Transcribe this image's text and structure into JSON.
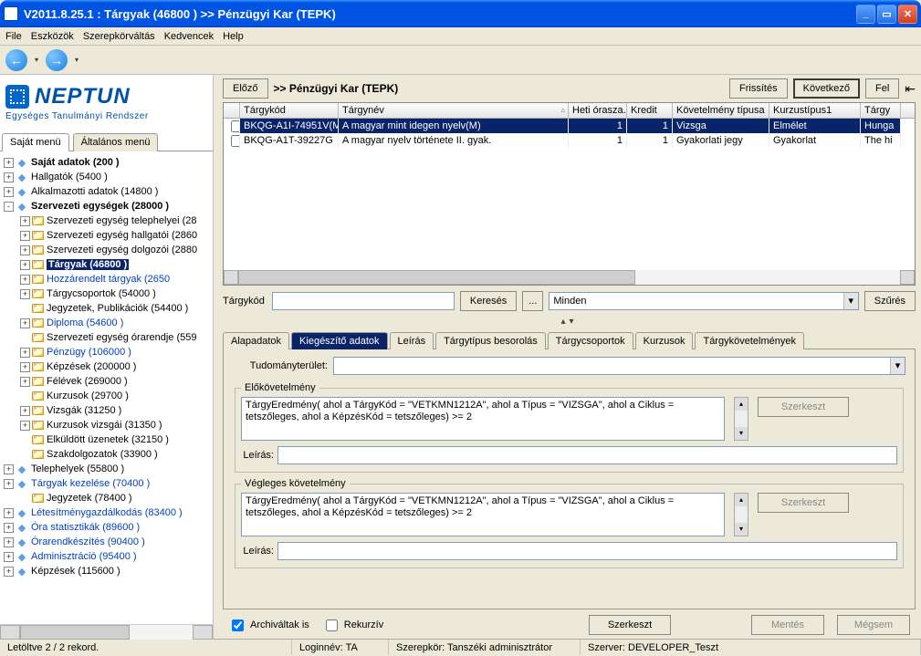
{
  "window": {
    "title": "V2011.8.25.1 : Tárgyak (46800 ) >> Pénzügyi Kar (TEPK)"
  },
  "menu": {
    "file": "File",
    "tools": "Eszközök",
    "role": "Szerepkörváltás",
    "fav": "Kedvencek",
    "help": "Help"
  },
  "logo": {
    "brand": "NEPTUN",
    "sub": "Egységes Tanulmányi Rendszer"
  },
  "left_tabs": {
    "own": "Saját menü",
    "general": "Általános menü"
  },
  "tree": [
    {
      "d": 0,
      "exp": "+",
      "icon": "diamond",
      "bold": true,
      "label": "Saját adatok (200 )"
    },
    {
      "d": 0,
      "exp": "+",
      "icon": "diamond",
      "label": "Hallgatók (5400 )"
    },
    {
      "d": 0,
      "exp": "+",
      "icon": "diamond",
      "label": "Alkalmazotti adatok (14800 )"
    },
    {
      "d": 0,
      "exp": "-",
      "icon": "diamond",
      "bold": true,
      "label": "Szervezeti egységek (28000 )"
    },
    {
      "d": 1,
      "exp": "+",
      "icon": "folder",
      "label": "Szervezeti egység telephelyei (28"
    },
    {
      "d": 1,
      "exp": "+",
      "icon": "folder",
      "label": "Szervezeti egység hallgatói (2860"
    },
    {
      "d": 1,
      "exp": "+",
      "icon": "folder",
      "label": "Szervezeti egység dolgozói (2880"
    },
    {
      "d": 1,
      "exp": "+",
      "icon": "folder",
      "bold": true,
      "sel": true,
      "label": "Tárgyak (46800 )"
    },
    {
      "d": 1,
      "exp": "+",
      "icon": "folder",
      "blue": true,
      "label": "Hozzárendelt tárgyak (2650 "
    },
    {
      "d": 1,
      "exp": "+",
      "icon": "folder",
      "label": "Tárgycsoportok (54000 )"
    },
    {
      "d": 1,
      "exp": "",
      "icon": "folder",
      "label": "Jegyzetek, Publikációk (54400 )"
    },
    {
      "d": 1,
      "exp": "+",
      "icon": "folder",
      "blue": true,
      "label": "Diploma (54600 )"
    },
    {
      "d": 1,
      "exp": "",
      "icon": "folder",
      "label": "Szervezeti egység órarendje (559"
    },
    {
      "d": 1,
      "exp": "+",
      "icon": "folder",
      "blue": true,
      "label": "Pénzügy (106000 )"
    },
    {
      "d": 1,
      "exp": "+",
      "icon": "folder",
      "label": "Képzések (200000 )"
    },
    {
      "d": 1,
      "exp": "+",
      "icon": "folder",
      "label": "Félévek (269000 )"
    },
    {
      "d": 1,
      "exp": "",
      "icon": "folder",
      "label": "Kurzusok (29700 )"
    },
    {
      "d": 1,
      "exp": "+",
      "icon": "folder",
      "label": "Vizsgák (31250 )"
    },
    {
      "d": 1,
      "exp": "+",
      "icon": "folder",
      "label": "Kurzusok vizsgái (31350 )"
    },
    {
      "d": 1,
      "exp": "",
      "icon": "folder",
      "label": "Elküldött üzenetek (32150 )"
    },
    {
      "d": 1,
      "exp": "",
      "icon": "folder",
      "label": "Szakdolgozatok (33900 )"
    },
    {
      "d": 0,
      "exp": "+",
      "icon": "diamond",
      "label": "Telephelyek (55800 )"
    },
    {
      "d": 0,
      "exp": "+",
      "icon": "diamond",
      "blue": true,
      "label": "Tárgyak kezelése (70400 )"
    },
    {
      "d": 1,
      "exp": "",
      "icon": "folder",
      "label": "Jegyzetek (78400 )"
    },
    {
      "d": 0,
      "exp": "+",
      "icon": "diamond",
      "blue": true,
      "label": "Létesítménygazdálkodás (83400 )"
    },
    {
      "d": 0,
      "exp": "+",
      "icon": "diamond",
      "blue": true,
      "label": "Óra statisztikák (89600 )"
    },
    {
      "d": 0,
      "exp": "+",
      "icon": "diamond",
      "blue": true,
      "label": "Órarendkészítés (90400 )"
    },
    {
      "d": 0,
      "exp": "+",
      "icon": "diamond",
      "blue": true,
      "label": "Adminisztráció (95400 )"
    },
    {
      "d": 0,
      "exp": "+",
      "icon": "diamond",
      "label": "Képzések (115600 )"
    }
  ],
  "top": {
    "prev": "Előző",
    "crumb": ">> Pénzügyi Kar (TEPK)",
    "refresh": "Frissítés",
    "next": "Következő",
    "up": "Fel"
  },
  "grid": {
    "cols": [
      "",
      "Tárgykód",
      "Tárgynév",
      "Heti órasza..",
      "Kredit",
      "Követelmény típusa",
      "Kurzustípus1",
      "Tárgy"
    ],
    "widths": [
      18,
      108,
      252,
      64,
      50,
      106,
      100,
      44
    ],
    "rows": [
      {
        "sel": true,
        "cells": [
          "",
          "BKQG-A1I-74951V(M",
          "A magyar mint idegen nyelv(M)",
          "1",
          "1",
          "Vizsga",
          "Elmélet",
          "Hunga"
        ]
      },
      {
        "sel": false,
        "cells": [
          "",
          "BKQG-A1T-39227G",
          "A magyar nyelv története II. gyak.",
          "1",
          "1",
          "Gyakorlati jegy",
          "Gyakorlat",
          "The hi"
        ]
      }
    ]
  },
  "search": {
    "label": "Tárgykód",
    "value": "",
    "btn_search": "Keresés",
    "btn_more": "...",
    "combo_value": "Minden",
    "btn_filter": "Szűrés"
  },
  "dtabs": [
    "Alapadatok",
    "Kiegészítő adatok",
    "Leírás",
    "Tárgytípus besorolás",
    "Tárgycsoportok",
    "Kurzusok",
    "Tárgykövetelmények"
  ],
  "detail": {
    "science_label": "Tudományterület:",
    "group1_title": "Előkövetelmény",
    "group1_text": "TárgyEredmény( ahol a TárgyKód = \"VETKMN1212A\", ahol a Típus = \"VIZSGA\", ahol a Ciklus = tetszőleges, ahol a KépzésKód = tetszőleges) >= 2",
    "group2_title": "Végleges követelmény",
    "group2_text": "TárgyEredmény( ahol a TárgyKód = \"VETKMN1212A\", ahol a Típus = \"VIZSGA\", ahol a Ciklus = tetszőleges, ahol a KépzésKód = tetszőleges) >= 2",
    "desc_label": "Leírás:",
    "btn_edit": "Szerkeszt"
  },
  "bottom": {
    "archived": "Archiváltak is",
    "recursive": "Rekurzív",
    "edit": "Szerkeszt",
    "save": "Mentés",
    "cancel": "Mégsem"
  },
  "status": {
    "loaded": "Letöltve 2 / 2 rekord.",
    "login": "Loginnév: TA",
    "role": "Szerepkör: Tanszéki adminisztrátor",
    "server": "Szerver: DEVELOPER_Teszt"
  }
}
